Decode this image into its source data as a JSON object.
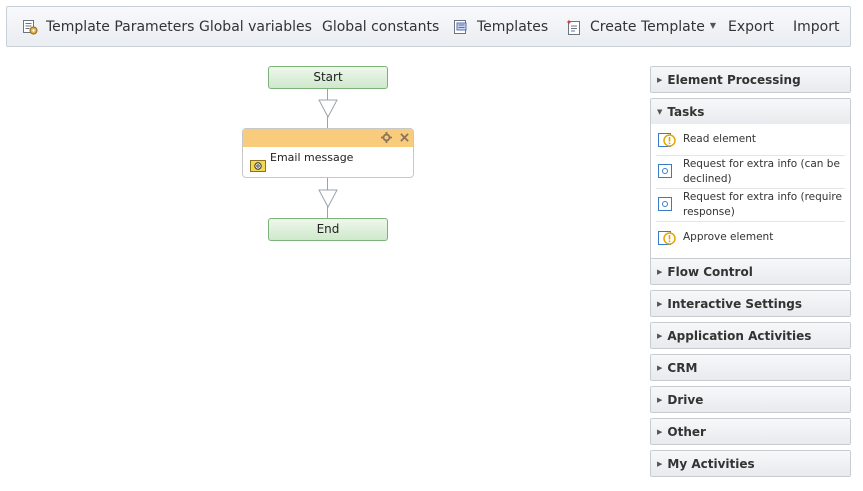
{
  "toolbar": {
    "template_parameters": "Template Parameters",
    "global_variables": "Global variables",
    "global_constants": "Global constants",
    "templates": "Templates",
    "create_template": "Create Template",
    "export": "Export",
    "import": "Import"
  },
  "flow": {
    "start_label": "Start",
    "task_label": "Email message",
    "end_label": "End"
  },
  "panel": {
    "sections": [
      {
        "title": "Element Processing",
        "expanded": false
      },
      {
        "title": "Tasks",
        "expanded": true
      },
      {
        "title": "Flow Control",
        "expanded": false
      },
      {
        "title": "Interactive Settings",
        "expanded": false
      },
      {
        "title": "Application Activities",
        "expanded": false
      },
      {
        "title": "CRM",
        "expanded": false
      },
      {
        "title": "Drive",
        "expanded": false
      },
      {
        "title": "Other",
        "expanded": false
      },
      {
        "title": "My Activities",
        "expanded": false
      }
    ],
    "tasks": [
      {
        "label": "Read element",
        "icon": "read-element-icon"
      },
      {
        "label": "Request for extra info (can be declined)",
        "icon": "request-info-icon"
      },
      {
        "label": "Request for extra info (require response)",
        "icon": "request-info-icon"
      },
      {
        "label": "Approve element",
        "icon": "approve-element-icon"
      }
    ]
  },
  "colors": {
    "pill_fill": "#cfe8cb",
    "pill_border": "#7fb27a",
    "task_header": "#f8cc7c",
    "warning_accent": "#e8a500",
    "link_blue": "#3a7bc8"
  }
}
